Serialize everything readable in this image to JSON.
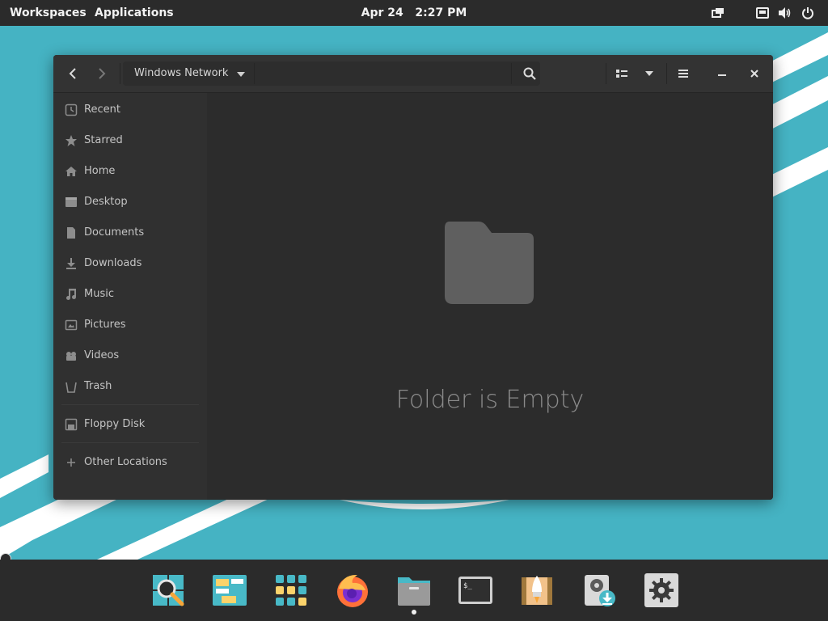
{
  "topbar": {
    "workspaces": "Workspaces",
    "applications": "Applications",
    "date": "Apr 24",
    "time": "2:27 PM"
  },
  "window": {
    "location": "Windows Network",
    "sidebar": {
      "items": [
        {
          "label": "Recent",
          "icon": "clock-icon"
        },
        {
          "label": "Starred",
          "icon": "star-icon"
        },
        {
          "label": "Home",
          "icon": "home-icon"
        },
        {
          "label": "Desktop",
          "icon": "desktop-icon"
        },
        {
          "label": "Documents",
          "icon": "document-icon"
        },
        {
          "label": "Downloads",
          "icon": "download-icon"
        },
        {
          "label": "Music",
          "icon": "music-icon"
        },
        {
          "label": "Pictures",
          "icon": "picture-icon"
        },
        {
          "label": "Videos",
          "icon": "video-icon"
        },
        {
          "label": "Trash",
          "icon": "trash-icon"
        }
      ],
      "devices": [
        {
          "label": "Floppy Disk",
          "icon": "floppy-icon"
        }
      ],
      "other": {
        "label": "Other Locations",
        "icon": "plus-icon"
      }
    },
    "empty_message": "Folder is Empty"
  },
  "dock": {
    "apps": [
      "search-app-icon",
      "workspaces-app-icon",
      "app-grid-icon",
      "firefox-icon",
      "files-icon",
      "terminal-icon",
      "launcher-icon",
      "installer-icon",
      "settings-icon"
    ]
  },
  "colors": {
    "wallpaper": "#45b3c3",
    "panel": "#2b2b2b",
    "window_bg": "#2c2c2c",
    "sidebar_bg": "#303030",
    "accent_orange": "#f6a63a"
  }
}
